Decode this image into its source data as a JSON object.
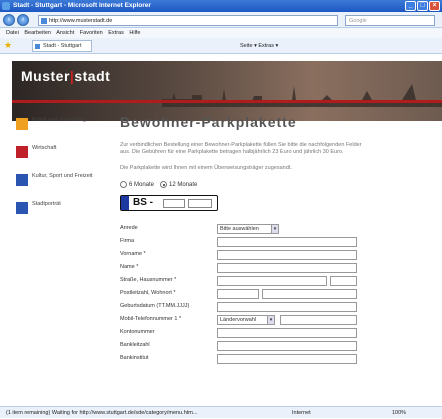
{
  "window": {
    "title": "Stadt - Stuttgart - Microsoft Internet Explorer"
  },
  "browser": {
    "url": "http://www.musterstadt.de",
    "search_placeholder": "Google",
    "menu": [
      "Datei",
      "Bearbeiten",
      "Ansicht",
      "Favoriten",
      "Extras",
      "Hilfe"
    ],
    "tab_label": "Stadt - Stuttgart",
    "tools": "Seite ▾  Extras ▾"
  },
  "site": {
    "logo_left": "Muster",
    "logo_sep": "|",
    "logo_right": "stadt"
  },
  "sidebar": {
    "items": [
      {
        "label": "Politik und Verwaltung",
        "icon": "politics-icon",
        "color": "#f0a020"
      },
      {
        "label": "Wirtschaft",
        "icon": "economy-icon",
        "color": "#c0202a"
      },
      {
        "label": "Kultur, Sport und Freizeit",
        "icon": "culture-icon",
        "color": "#2a55b0"
      },
      {
        "label": "Stadtporträt",
        "icon": "portrait-icon",
        "color": "#2a55b0"
      }
    ]
  },
  "main": {
    "title": "Bewohner-Parkplakette",
    "intro": "Zur verbindlichen Bestellung einer Bewohner-Parkplakette füllen Sie bitte die nachfolgenden Felder aus. Die Gebühren für eine Parkplakette betragen halbjährlich 23 Euro und jährlich 30 Euro.",
    "transfer_note": "Die Parkplakette wird Ihnen mit einem Überweisungsträger zugesandt.",
    "radio_6": "6 Monate",
    "radio_12": "12 Monate",
    "plate_code": "BS -",
    "form": {
      "anrede_label": "Anrede",
      "anrede_value": "Bitte auswählen",
      "firma_label": "Firma",
      "vorname_label": "Vorname *",
      "name_label": "Name *",
      "strasse_label": "Straße, Hausnummer *",
      "plz_label": "Postleitzahl, Wohnort *",
      "geburtsdatum_label": "Geburtsdatum (TT.MM.JJJJ)",
      "mobil_label": "Mobil-Telefonnummer 1 *",
      "laendervorwahl_value": "Ländervorwahl",
      "kontonummer_label": "Kontonummer",
      "bankleitzahl_label": "Bankleitzahl",
      "bankinstitut_label": "Bankinstitut"
    }
  },
  "status": {
    "text": "(1 item remaining) Waiting for http://www.stuttgart.de/sde/category/menu.htm...",
    "zone": "Internet",
    "zoom": "100%"
  }
}
